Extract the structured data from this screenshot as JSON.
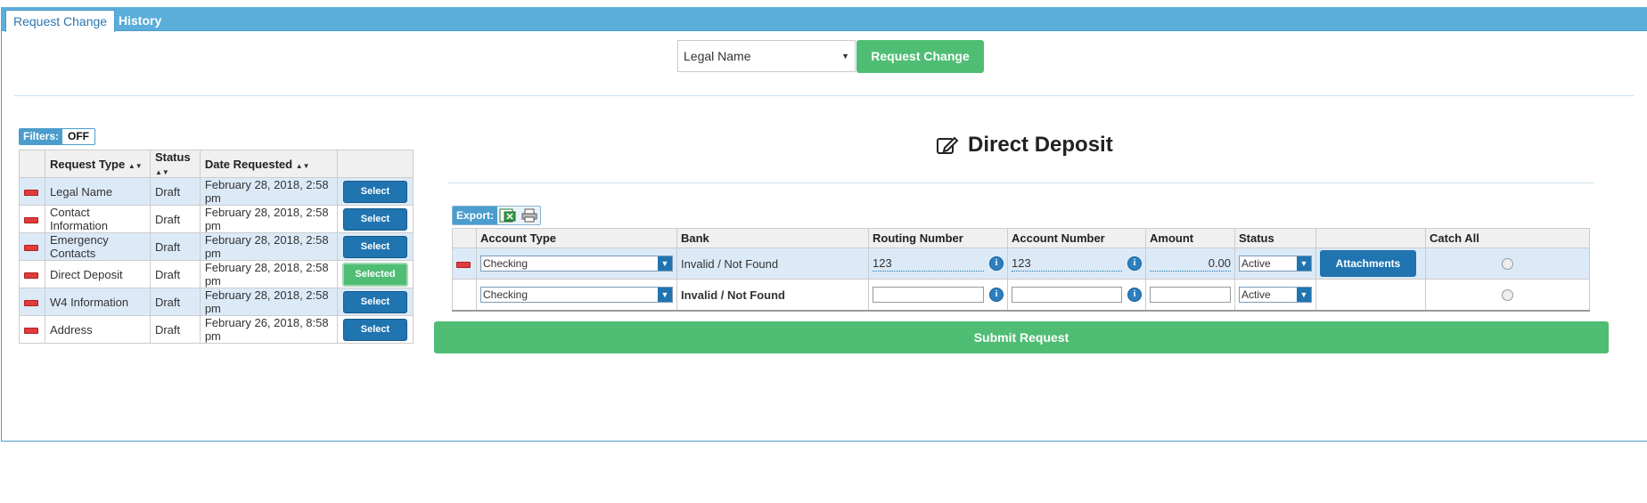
{
  "tabs": {
    "active": "Request Change",
    "inactive": "History"
  },
  "top": {
    "select_value": "Legal Name",
    "button": "Request Change"
  },
  "filters": {
    "label": "Filters:",
    "value": "OFF"
  },
  "requests": {
    "headers": [
      "Request Type",
      "Status",
      "Date Requested"
    ],
    "rows": [
      {
        "type": "Legal Name",
        "status": "Draft",
        "date": "February 28, 2018, 2:58 pm",
        "button": "Select"
      },
      {
        "type": "Contact Information",
        "status": "Draft",
        "date": "February 28, 2018, 2:58 pm",
        "button": "Select"
      },
      {
        "type": "Emergency Contacts",
        "status": "Draft",
        "date": "February 28, 2018, 2:58 pm",
        "button": "Select"
      },
      {
        "type": "Direct Deposit",
        "status": "Draft",
        "date": "February 28, 2018, 2:58 pm",
        "button": "Selected"
      },
      {
        "type": "W4 Information",
        "status": "Draft",
        "date": "February 28, 2018, 2:58 pm",
        "button": "Select"
      },
      {
        "type": "Address",
        "status": "Draft",
        "date": "February 26, 2018, 8:58 pm",
        "button": "Select"
      }
    ]
  },
  "section_title": "Direct Deposit",
  "export": {
    "label": "Export:"
  },
  "deposit": {
    "headers": [
      "Account Type",
      "Bank",
      "Routing Number",
      "Account Number",
      "Amount",
      "Status",
      "Catch All"
    ],
    "rows": [
      {
        "account_type": "Checking",
        "bank": "Invalid / Not Found",
        "routing": "123",
        "account": "123",
        "amount": "0.00",
        "status": "Active",
        "attach": "Attachments"
      },
      {
        "account_type": "Checking",
        "bank": "Invalid / Not Found",
        "routing": "",
        "account": "",
        "amount": "",
        "status": "Active"
      }
    ]
  },
  "submit": "Submit Request",
  "icons": {
    "edit": "edit-icon",
    "excel": "excel-icon",
    "print": "print-icon",
    "info": "info-icon",
    "remove": "remove-icon"
  },
  "colors": {
    "tab_blue": "#5aaed9",
    "green": "#4fbd74",
    "button_blue": "#2074b0",
    "row_blue": "#dceaf8"
  }
}
